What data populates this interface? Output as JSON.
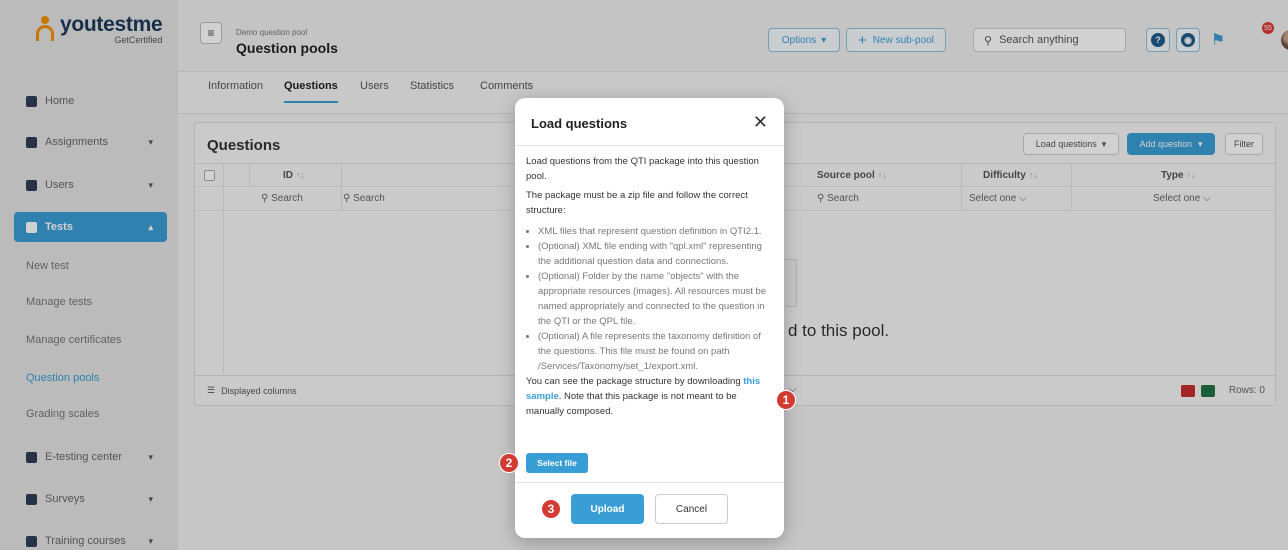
{
  "logo": {
    "name_prefix": "youtest",
    "name_suffix": "me",
    "tagline": "GetCertified"
  },
  "sidebar": {
    "items": [
      {
        "label": "Home",
        "icon": "home-icon"
      },
      {
        "label": "Assignments",
        "icon": "assignments-icon"
      },
      {
        "label": "Users",
        "icon": "users-icon"
      },
      {
        "label": "Tests",
        "icon": "tests-icon"
      },
      {
        "label": "E-testing center",
        "icon": "calendar-icon"
      },
      {
        "label": "Surveys",
        "icon": "surveys-icon"
      },
      {
        "label": "Training courses",
        "icon": "trophy-icon"
      }
    ],
    "sub_items": [
      "New test",
      "Manage tests",
      "Manage certificates",
      "Question pools",
      "Grading scales"
    ],
    "active_item": "Tests",
    "current_sub_item": "Question pools"
  },
  "header": {
    "breadcrumb": "Demo question pool",
    "title": "Question pools",
    "options_label": "Options",
    "new_subpool_label": "New sub-pool",
    "search_placeholder": "Search anything",
    "notification_count": "55"
  },
  "tabs": [
    "Information",
    "Questions",
    "Users",
    "Statistics",
    "Comments"
  ],
  "active_tab": "Questions",
  "panel": {
    "title": "Questions",
    "load_questions_label": "Load questions",
    "add_question_label": "Add question",
    "filter_label": "Filter",
    "columns": [
      "ID",
      "Source pool",
      "Difficulty",
      "Type"
    ],
    "filters": {
      "id": "Search",
      "text": "Search",
      "source_pool": "Search",
      "difficulty": "Select one",
      "type": "Select one"
    },
    "empty_message": "d to this pool.",
    "displayed_columns_label": "Displayed columns",
    "rows_label": "Rows: 0"
  },
  "modal": {
    "title": "Load questions",
    "intro": "Load questions from the QTI package into this question pool.",
    "structure_note": "The package must be a zip file and follow the correct structure:",
    "bullets": [
      "XML files that represent question definition in QTI2.1.",
      "(Optional) XML file ending with \"qpl.xml\" representing the additional question data and connections.",
      "(Optional) Folder by the name \"objects\" with the appropriate resources (images). All resources must be named appropriately and connected to the question in the QTI or the QPL file.",
      "(Optional) A file represents the taxonomy definition of the questions. This file must be found on path /Services/Taxonomy/set_1/export.xml."
    ],
    "sample_prefix": "You can see the package structure by downloading ",
    "sample_link": "this sample",
    "sample_suffix": ". Note that this package is not meant to be manually composed.",
    "select_file_label": "Select file",
    "upload_label": "Upload",
    "cancel_label": "Cancel"
  },
  "markers": [
    "1",
    "2",
    "3"
  ]
}
